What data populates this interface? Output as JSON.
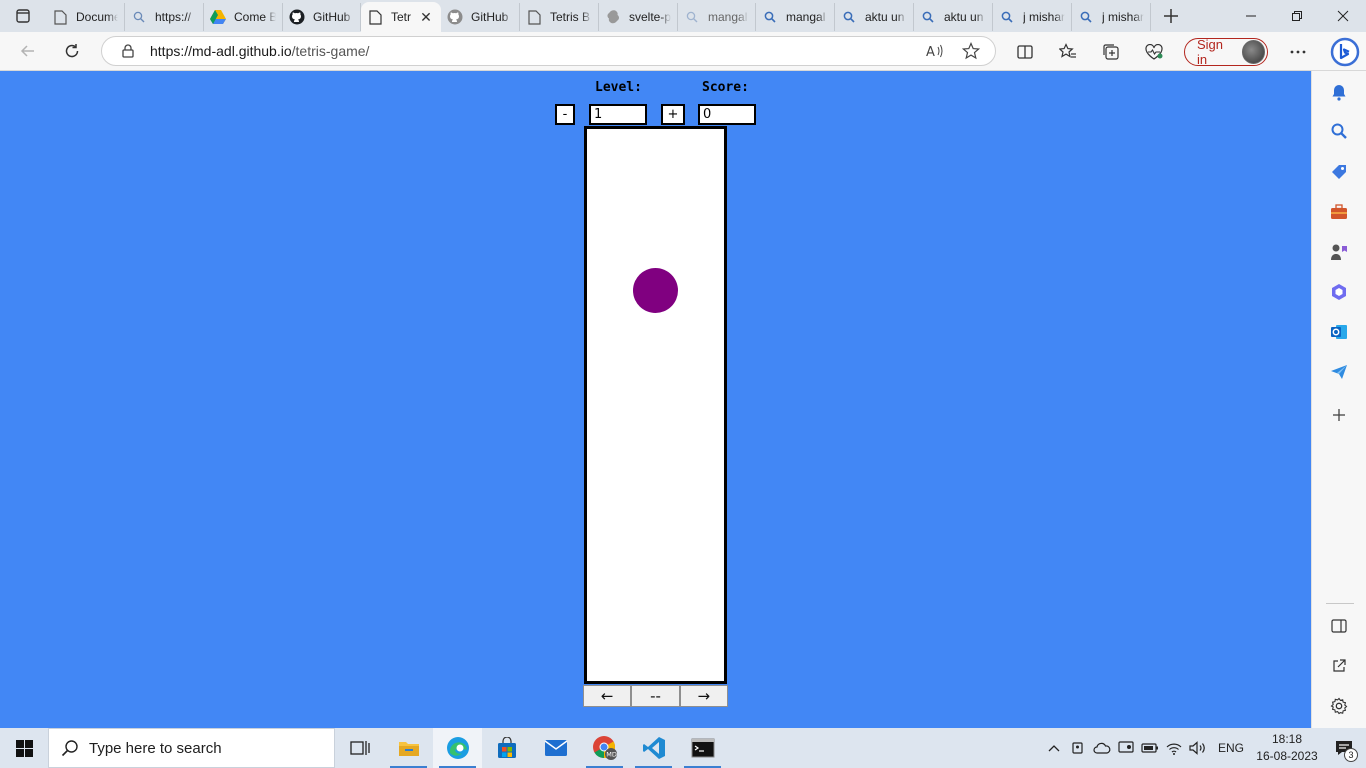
{
  "browser": {
    "tabs": [
      {
        "label": "Docume",
        "icon": "document-icon",
        "active": false
      },
      {
        "label": "https://",
        "icon": "search-icon",
        "active": false
      },
      {
        "label": "Come B",
        "icon": "drive-icon",
        "active": false
      },
      {
        "label": "GitHub",
        "icon": "github-icon",
        "active": false
      },
      {
        "label": "Tetr",
        "icon": "document-icon",
        "active": true
      },
      {
        "label": "GitHub",
        "icon": "github-icon",
        "active": false
      },
      {
        "label": "Tetris B",
        "icon": "document-icon",
        "active": false
      },
      {
        "label": "svelte-p",
        "icon": "svelte-icon",
        "active": false
      },
      {
        "label": "mangal",
        "icon": "search-icon",
        "active": false
      },
      {
        "label": "mangal",
        "icon": "search-icon",
        "active": false
      },
      {
        "label": "aktu un",
        "icon": "search-icon",
        "active": false
      },
      {
        "label": "aktu un",
        "icon": "search-icon",
        "active": false
      },
      {
        "label": "j mishar",
        "icon": "search-icon",
        "active": false
      },
      {
        "label": "j mishar",
        "icon": "search-icon",
        "active": false
      }
    ],
    "address": {
      "host": "https://md-adl.github.io",
      "path": "/tetris-game/"
    },
    "signin_label": "Sign in"
  },
  "game": {
    "level_label": "Level:",
    "score_label": "Score:",
    "minus_label": "-",
    "plus_label": "+",
    "level_value": "1",
    "score_value": "0",
    "piece_color": "#800080",
    "background_color": "#4287f5",
    "controls": {
      "left": "←",
      "middle": "--",
      "right": "→"
    }
  },
  "taskbar": {
    "search_placeholder": "Type here to search",
    "language": "ENG",
    "time": "18:18",
    "date": "16-08-2023",
    "notification_count": "3"
  }
}
